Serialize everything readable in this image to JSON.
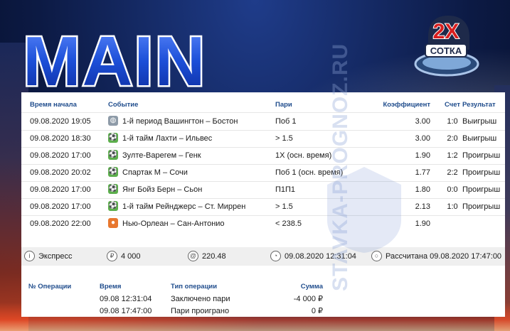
{
  "banner": {
    "title": "MAIN",
    "badge_top": "2X",
    "badge_bottom": "СОТКА"
  },
  "watermark": "STAVKA-PROGNOZ.RU",
  "bets": {
    "headers": {
      "time": "Время начала",
      "event": "Событие",
      "bet": "Пари",
      "coef": "Коэффициент",
      "score": "Счет",
      "result": "Результат"
    },
    "rows": [
      {
        "time": "09.08.2020 19:05",
        "sport_icon": "hockey-icon",
        "event": "1-й период Вашингтон – Бостон",
        "bet": "Поб 1",
        "coef": "3.00",
        "score": "1:0",
        "result": "Выигрыш"
      },
      {
        "time": "09.08.2020 18:30",
        "sport_icon": "soccer-icon",
        "event": "1-й тайм Лахти – Ильвес",
        "bet": "> 1.5",
        "coef": "3.00",
        "score": "2:0",
        "result": "Выигрыш"
      },
      {
        "time": "09.08.2020 17:00",
        "sport_icon": "soccer-icon",
        "event": "Зулте-Варегем – Генк",
        "bet": "1X (осн. время)",
        "coef": "1.90",
        "score": "1:2",
        "result": "Проигрыш"
      },
      {
        "time": "09.08.2020 20:02",
        "sport_icon": "soccer-icon",
        "event": "Спартак М – Сочи",
        "bet": "Поб 1 (осн. время)",
        "coef": "1.77",
        "score": "2:2",
        "result": "Проигрыш"
      },
      {
        "time": "09.08.2020 17:00",
        "sport_icon": "soccer-icon",
        "event": "Янг Бойз Берн – Сьон",
        "bet": "П1П1",
        "coef": "1.80",
        "score": "0:0",
        "result": "Проигрыш"
      },
      {
        "time": "09.08.2020 17:00",
        "sport_icon": "soccer-icon",
        "event": "1-й тайм Рейнджерс – Ст. Миррен",
        "bet": "> 1.5",
        "coef": "2.13",
        "score": "1:0",
        "result": "Проигрыш"
      },
      {
        "time": "09.08.2020 22:00",
        "sport_icon": "basketball-icon",
        "event": "Нью-Орлеан – Сан-Антонио",
        "bet": "< 238.5",
        "coef": "1.90",
        "score": "",
        "result": ""
      }
    ]
  },
  "summary": {
    "type": "Экспресс",
    "stake": "4 000",
    "coef": "220.48",
    "placed": "09.08.2020 12:31:04",
    "status": "Рассчитана 09.08.2020 17:47:00"
  },
  "operations": {
    "headers": {
      "num": "№ Операции",
      "time": "Время",
      "type": "Тип операции",
      "sum": "Сумма"
    },
    "rows": [
      {
        "num": "",
        "time": "09.08 12:31:04",
        "type": "Заключено пари",
        "sum": "-4 000 ₽"
      },
      {
        "num": "",
        "time": "09.08 17:47:00",
        "type": "Пари проиграно",
        "sum": "0 ₽"
      }
    ]
  },
  "colors": {
    "header_text": "#1f4c8c",
    "title_fill": "#1c4fd8",
    "badge_red": "#d81e1e"
  }
}
